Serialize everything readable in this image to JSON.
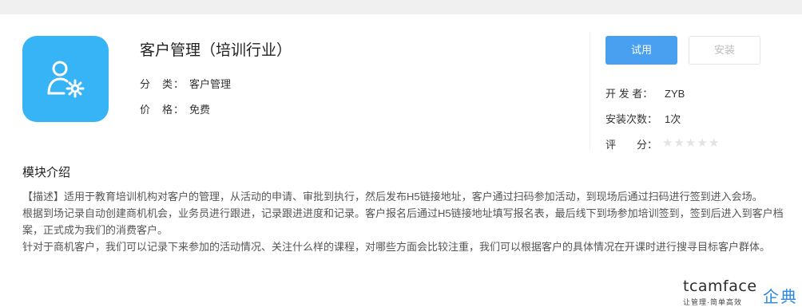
{
  "app": {
    "name": "客户管理（培训行业）",
    "icon": "user-gear-icon",
    "icon_bg": "#36b4f5",
    "category_label": "分　类：",
    "category_value": "客户管理",
    "price_label": "价　格：",
    "price_value": "免费"
  },
  "actions": {
    "trial_label": "试用",
    "install_label": "安装",
    "accent": "#4aa0f0"
  },
  "info": {
    "developer_label": "开 发 者：",
    "developer_value": "ZYB",
    "installs_label": "安装次数：",
    "installs_value": "1次",
    "rating_label": "评　　分：",
    "rating_value": 0,
    "rating_max": 5
  },
  "intro": {
    "title": "模块介绍",
    "paragraphs": [
      "【描述】适用于教育培训机构对客户的管理，从活动的申请、审批到执行，然后发布H5链接地址，客户通过扫码参加活动，到现场后通过扫码进行签到进入会场。",
      "根据到场记录自动创建商机机会，业务员进行跟进，记录跟进进度和记录。客户报名后通过H5链接地址填写报名表，最后线下到场参加培训签到，签到后进入到客户档案，正式成为我们的消费客户。",
      "针对于商机客户，我们可以记录下来参加的活动情况、关注什么样的课程，对哪些方面会比较注重，我们可以根据客户的具体情况在开课时进行搜寻目标客户群体。"
    ]
  },
  "watermark": {
    "latin": "tcamface",
    "cn": "企典",
    "slogan": "让管理·简单高效"
  }
}
